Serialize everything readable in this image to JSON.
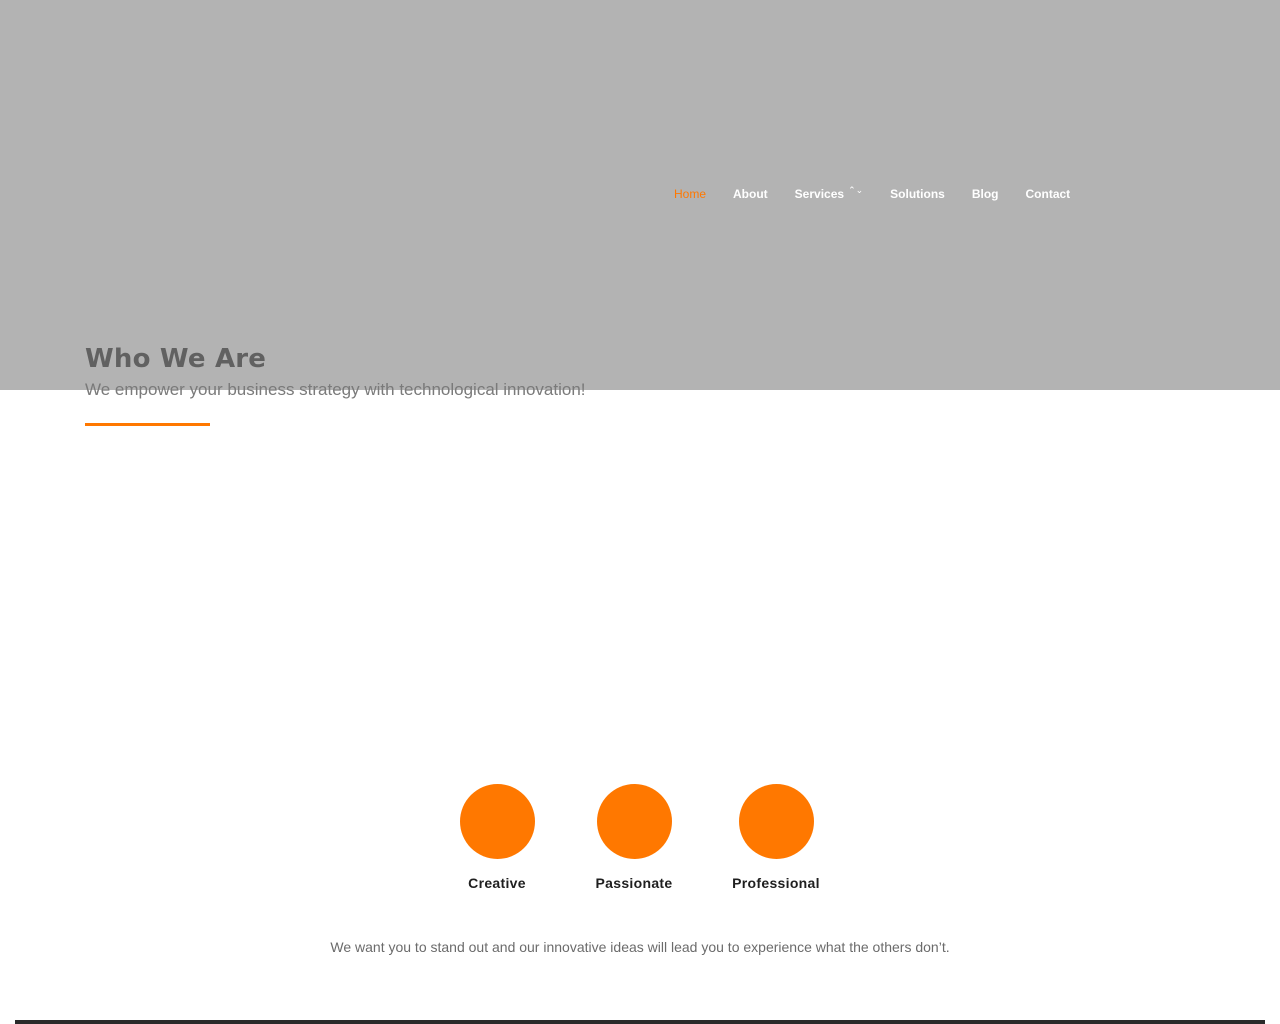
{
  "nav": {
    "items": [
      {
        "label": "Home",
        "active": true
      },
      {
        "label": "About"
      },
      {
        "label": "Services",
        "has_dropdown": true,
        "icon": "chevron-down-icon"
      },
      {
        "label": "Solutions"
      },
      {
        "label": "Blog"
      },
      {
        "label": "Contact"
      }
    ]
  },
  "about": {
    "title": "Who We Are",
    "subtitle": "We empower your business strategy with technological innovation!"
  },
  "features": [
    {
      "label": "Creative"
    },
    {
      "label": "Passionate"
    },
    {
      "label": "Professional"
    }
  ],
  "tagline": "We want you to stand out and our innovative ideas will lead you to experience what the others don’t.",
  "colors": {
    "accent": "#ff7800",
    "hero_bg": "#b3b3b3",
    "title": "#616161",
    "nav_text": "#ffffff"
  }
}
